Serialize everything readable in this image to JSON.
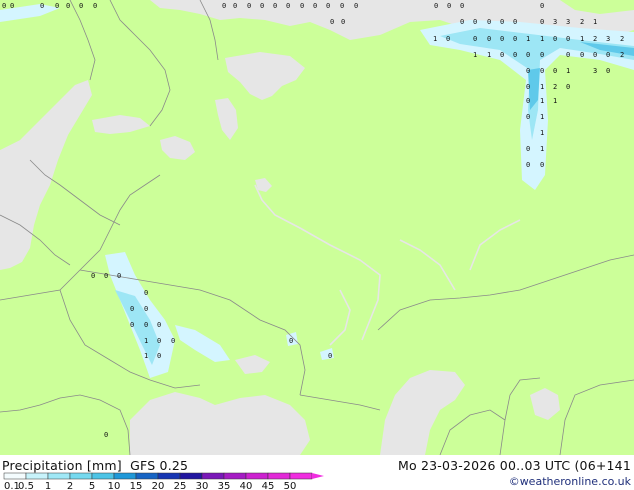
{
  "header": {
    "left_title": "Precipitation [mm]",
    "model": "GFS 0.25",
    "valid_time": "Mo 23-03-2026 00..03 UTC (06+141",
    "credit": "©weatheronline.co.uk"
  },
  "legend": {
    "ticks": [
      "0.1",
      "0.5",
      "1",
      "2",
      "5",
      "10",
      "15",
      "20",
      "25",
      "30",
      "35",
      "40",
      "45",
      "50"
    ],
    "colors": [
      "#f4fcfe",
      "#c8f3fb",
      "#a0e8f6",
      "#75d9ef",
      "#4dc4e6",
      "#1f98d8",
      "#1764c4",
      "#1736b3",
      "#2216a0",
      "#7a18b8",
      "#a51cc4",
      "#cc22d0",
      "#e22ad8",
      "#f02ee0"
    ]
  },
  "map_colors": {
    "land": "#ccff99",
    "sea": "#e6e6e6",
    "precip_light": "#d4f5ff",
    "precip_mid": "#9de6f5",
    "precip_heavy": "#5fc9ea",
    "border": "#8a8a8a"
  },
  "precip_values": [
    "0",
    "0",
    "0",
    "0",
    "0",
    "0",
    "0",
    "0",
    "0",
    "0",
    "0",
    "0",
    "0",
    "0",
    "0",
    "0",
    "0",
    "0",
    "0",
    "0",
    "0",
    "0",
    "0",
    "0",
    "0",
    "0",
    "0",
    "0",
    "0",
    "0",
    "3",
    "3",
    "2",
    "1",
    "1",
    "0",
    "0",
    "0",
    "0",
    "0",
    "1",
    "1",
    "0",
    "0",
    "1",
    "2",
    "3",
    "2",
    "1",
    "1",
    "0",
    "0",
    "0",
    "0",
    "0",
    "0",
    "0",
    "0",
    "2",
    "0",
    "0",
    "0",
    "1",
    "3",
    "0",
    "0",
    "1",
    "2",
    "0",
    "0",
    "1",
    "1",
    "0",
    "1",
    "1",
    "0",
    "1",
    "0",
    "0",
    "0",
    "0",
    "0",
    "0",
    "0",
    "0",
    "0",
    "0",
    "0",
    "1",
    "0",
    "0",
    "1",
    "0",
    "0",
    "0",
    "0"
  ]
}
